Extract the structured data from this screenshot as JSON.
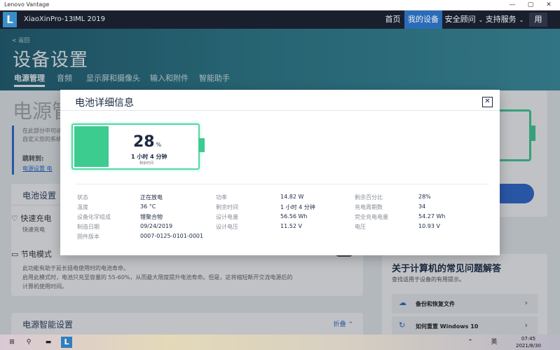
{
  "window": {
    "title": "Lenovo Vantage",
    "controls": [
      "—",
      "▢",
      "✕"
    ]
  },
  "nav": {
    "logo": "L",
    "device": "XiaoXinPro-13IML 2019",
    "items": [
      {
        "label": "首页"
      },
      {
        "label": "我的设备",
        "active": true
      },
      {
        "label": "安全顾问"
      },
      {
        "label": "支持服务"
      }
    ],
    "chev": "⌄",
    "user": "用"
  },
  "header": {
    "back": "< 返回",
    "title": "设备设置",
    "tabs": [
      "电源管理",
      "音频",
      "显示屏和摄像头",
      "输入和附件",
      "智能助手"
    ]
  },
  "page": {
    "big_title": "电源管",
    "desc_lines": [
      "在此部分中可动",
      "自定义您的系统"
    ],
    "jump": "跳转到:",
    "links": "电源设置   电",
    "battery_settings": {
      "title": "电池设置",
      "quick_charge": "快速充电",
      "quick_charge_sub": "快速充电",
      "conservation": "节电模式",
      "conservation_desc": [
        "此功能有助于延长插电使用时的电池寿命。",
        "启用此模式时，电池只充至容量的 55-60%，从而最大限度提升电池寿命。但是，这将缩短断开交流电源后的",
        "计算机使用时间。"
      ]
    },
    "smart_power": {
      "title": "电源智能设置",
      "collapse": "折叠 ⌃"
    },
    "faq": {
      "title": "关于计算机的常见问题解答",
      "sub": "查找适用于设备的有用提示。",
      "items": [
        {
          "icon": "☁",
          "label": "备份和恢复文件"
        },
        {
          "icon": "↻",
          "label": "如何重置 Windows 10"
        }
      ],
      "arrow": "›"
    }
  },
  "modal": {
    "title": "电池详细信息",
    "close": "✕",
    "battery": {
      "percent": "28",
      "percent_sign": "%",
      "level": 0.28,
      "remaining": "1 小时 4 分钟",
      "remaining_label": "剩余时间"
    },
    "details": [
      [
        {
          "k": "状态",
          "v": "正在放电"
        },
        {
          "k": "功率",
          "v": "14.82 W"
        },
        {
          "k": "剩余百分比",
          "v": "28%"
        }
      ],
      [
        {
          "k": "温度",
          "v": "36 °C"
        },
        {
          "k": "剩余时间",
          "v": "1 小时 4 分钟"
        },
        {
          "k": "充电周期数",
          "v": "34"
        }
      ],
      [
        {
          "k": "设备化学组成",
          "v": "锂聚合物"
        },
        {
          "k": "设计电量",
          "v": "56.56 Wh"
        },
        {
          "k": "完全充电电量",
          "v": "54.27 Wh"
        }
      ],
      [
        {
          "k": "制造日期",
          "v": "09/24/2019"
        },
        {
          "k": "设计电压",
          "v": "11.52 V"
        },
        {
          "k": "电压",
          "v": "10.93 V"
        }
      ],
      [
        {
          "k": "固件版本",
          "v": "0007-0125-0101-0001"
        }
      ]
    ]
  },
  "taskbar": {
    "start_icon": "⊞",
    "search_icon": "⚲",
    "app": "L",
    "tray": "⌃",
    "ime": "英",
    "time": "07:45",
    "date": "2021/8/30"
  },
  "colors": {
    "accent": "#2f6ad1",
    "battery": "#3dcc8f",
    "nav_bg": "#1a1f2e"
  }
}
